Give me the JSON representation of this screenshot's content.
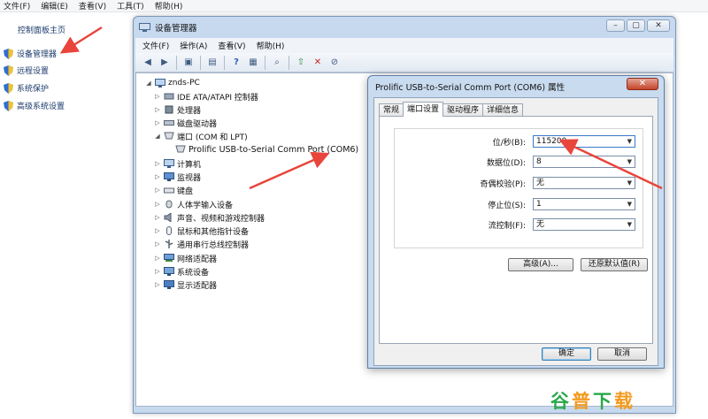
{
  "background_panel": {
    "menu": [
      "文件(F)",
      "编辑(E)",
      "查看(V)",
      "工具(T)",
      "帮助(H)"
    ],
    "home_link": "控制面板主页",
    "links": [
      "设备管理器",
      "远程设置",
      "系统保护",
      "高级系统设置"
    ]
  },
  "device_manager": {
    "title": "设备管理器",
    "menu": [
      "文件(F)",
      "操作(A)",
      "查看(V)",
      "帮助(H)"
    ],
    "window_buttons": [
      "–",
      "▢",
      "✕"
    ],
    "tree": {
      "root": "znds-PC",
      "items": [
        "IDE ATA/ATAPI 控制器",
        "处理器",
        "磁盘驱动器",
        "端口 (COM 和 LPT)",
        "Prolific USB-to-Serial Comm Port (COM6)",
        "计算机",
        "监视器",
        "键盘",
        "人体学输入设备",
        "声音、视频和游戏控制器",
        "鼠标和其他指针设备",
        "通用串行总线控制器",
        "网络适配器",
        "系统设备",
        "显示适配器"
      ]
    }
  },
  "properties_dialog": {
    "title": "Prolific USB-to-Serial Comm Port (COM6) 属性",
    "close_label": "✕",
    "tabs": [
      "常规",
      "端口设置",
      "驱动程序",
      "详细信息"
    ],
    "active_tab": "端口设置",
    "fields": [
      {
        "label": "位/秒(B):",
        "value": "115200"
      },
      {
        "label": "数据位(D):",
        "value": "8"
      },
      {
        "label": "奇偶校验(P):",
        "value": "无"
      },
      {
        "label": "停止位(S):",
        "value": "1"
      },
      {
        "label": "流控制(F):",
        "value": "无"
      }
    ],
    "advanced_button": "高级(A)...",
    "restore_button": "还原默认值(R)",
    "ok_button": "确定",
    "cancel_button": "取消"
  },
  "watermark": {
    "chars": [
      "谷",
      "普",
      "下",
      "载"
    ]
  },
  "colors": {
    "annotation_arrow": "#e8453c",
    "watermark_green": "#2aa84a",
    "watermark_orange": "#f39a1e"
  }
}
